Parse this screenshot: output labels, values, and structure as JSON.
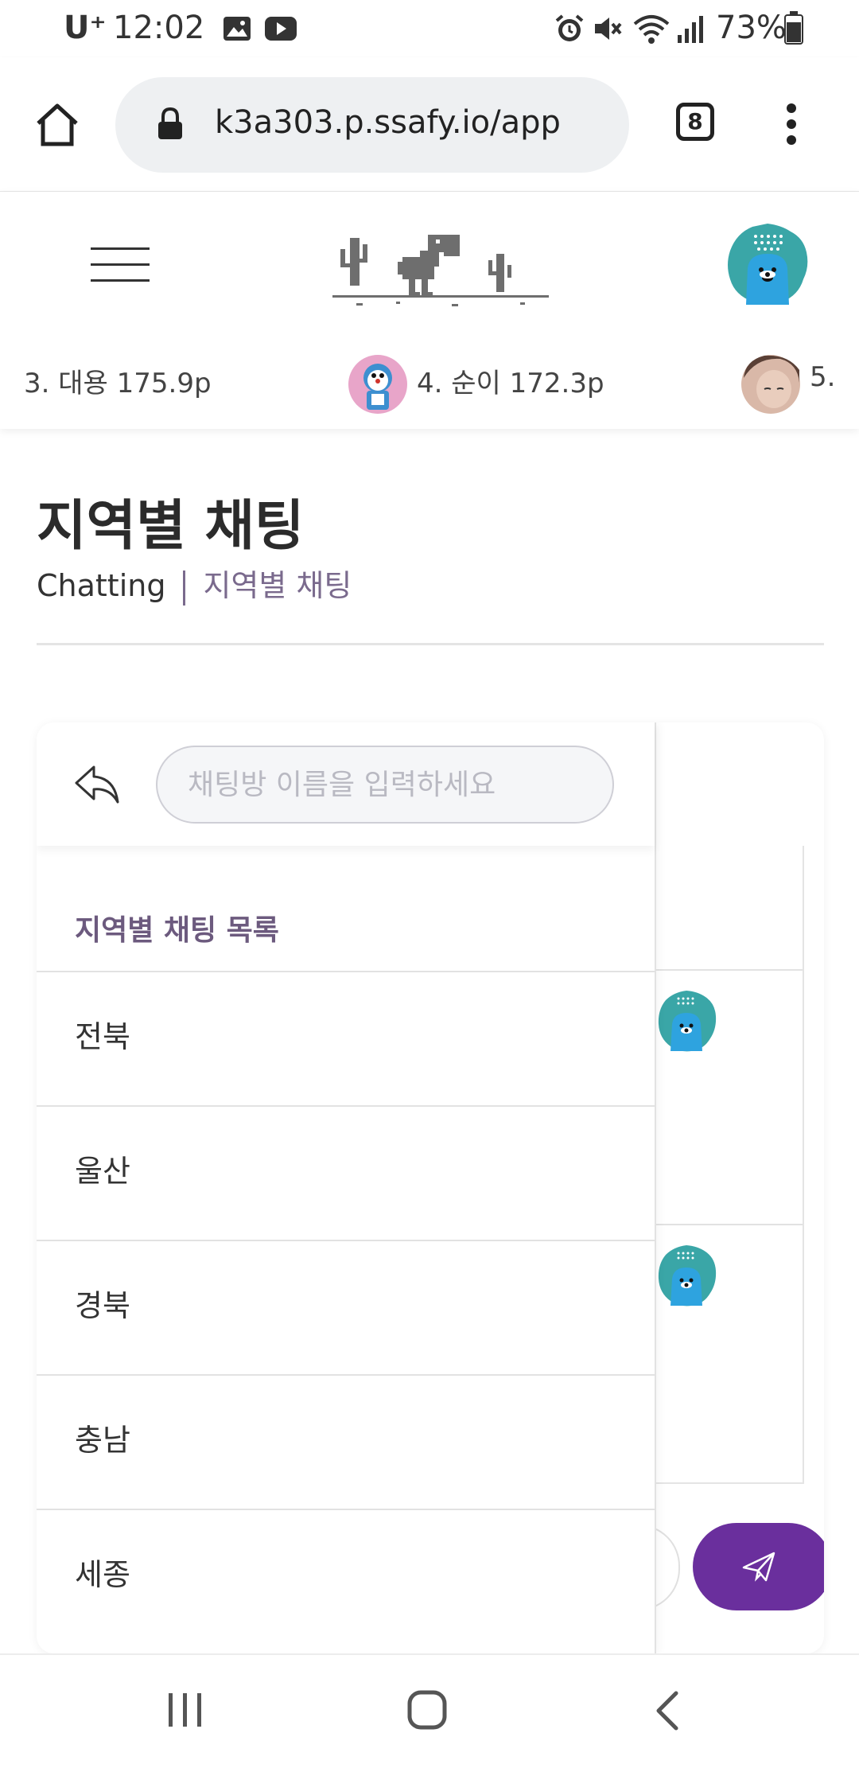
{
  "status_bar": {
    "carrier": "U⁺",
    "time": "12:02",
    "battery": "73%"
  },
  "browser": {
    "url": "k3a303.p.ssafy.io/app",
    "tab_count": "8"
  },
  "ranking": [
    {
      "label": "3. 대용 175.9p"
    },
    {
      "label": "4. 순이 172.3p"
    },
    {
      "label": "5."
    }
  ],
  "page": {
    "title": "지역별 채팅",
    "breadcrumb_root": "Chatting",
    "breadcrumb_current": "지역별 채팅"
  },
  "chat": {
    "search_placeholder": "채팅방 이름을 입력하세요",
    "list_header": "지역별 채팅 목록",
    "regions": [
      "전북",
      "울산",
      "경북",
      "충남",
      "세종"
    ]
  },
  "colors": {
    "accent": "#6a2f9d",
    "breadcrumb": "#7a6a8d",
    "avatar_teal": "#3aa6a7",
    "avatar_blue": "#2ea3df"
  },
  "icons": [
    "home-icon",
    "lock-icon",
    "more-icon",
    "menu-icon",
    "back-icon",
    "send-icon",
    "recents-icon",
    "nav-home-icon",
    "nav-back-icon"
  ]
}
